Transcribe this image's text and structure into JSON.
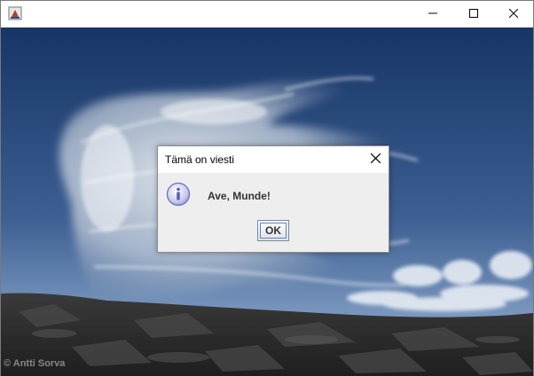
{
  "window": {
    "icons": {
      "app": "java-app-icon",
      "minimize": "minimize-icon",
      "maximize": "maximize-icon",
      "close": "close-icon"
    }
  },
  "background": {
    "credit": "© Antti Sorva",
    "colors": {
      "sky_top": "#1b3a6b",
      "sky_bottom": "#6f8fb8",
      "rock": "#2e2e2e"
    }
  },
  "dialog": {
    "title": "Tämä on viesti",
    "message": "Ave, Munde!",
    "ok_label": "OK",
    "icon": "info-icon",
    "close_icon": "close-icon"
  }
}
